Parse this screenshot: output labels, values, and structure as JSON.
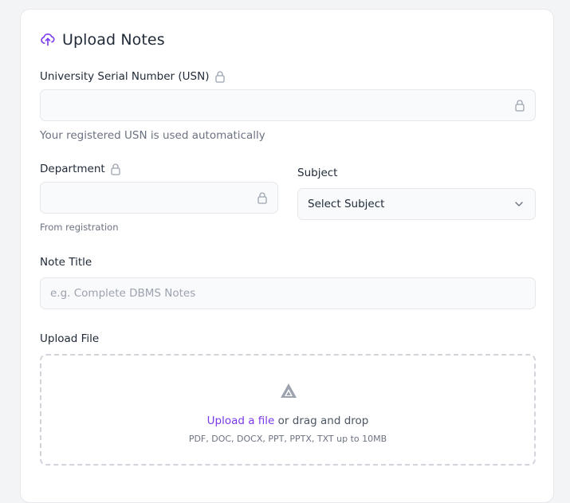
{
  "form": {
    "title": "Upload Notes",
    "title_icon": "cloud-upload-icon",
    "usn": {
      "label": "University Serial Number (USN)",
      "value": "",
      "hint": "Your registered USN is used automatically"
    },
    "department": {
      "label": "Department",
      "value": "",
      "hint": "From registration"
    },
    "subject": {
      "label": "Subject",
      "selected": "Select Subject"
    },
    "note_title": {
      "label": "Note Title",
      "placeholder": "e.g. Complete DBMS Notes"
    },
    "upload": {
      "label": "Upload File",
      "link": "Upload a file",
      "link_suffix": " or drag and drop",
      "formats": "PDF, DOC, DOCX, PPT, PPTX, TXT up to 10MB"
    }
  },
  "colors": {
    "accent": "#7c3aed",
    "muted": "#6b7280",
    "border": "#e5e7eb"
  }
}
